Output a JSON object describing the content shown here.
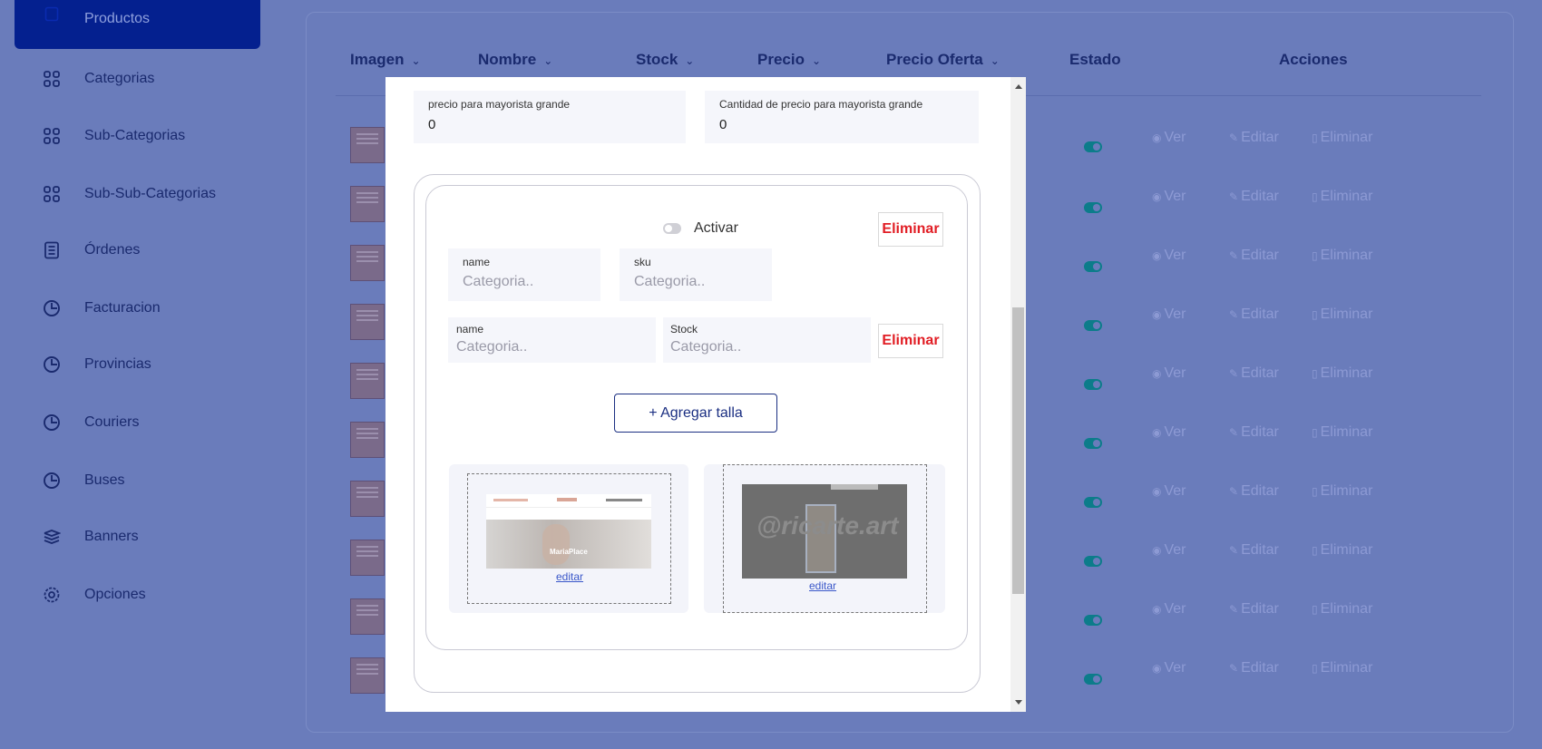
{
  "sidebar": {
    "items": [
      {
        "label": "Productos",
        "icon": "clipboard-icon",
        "active": true
      },
      {
        "label": "Categorias",
        "icon": "grid-icon"
      },
      {
        "label": "Sub-Categorias",
        "icon": "grid-icon"
      },
      {
        "label": "Sub-Sub-Categorias",
        "icon": "grid-icon"
      },
      {
        "label": "Órdenes",
        "icon": "document-icon"
      },
      {
        "label": "Facturacion",
        "icon": "clock-icon"
      },
      {
        "label": "Provincias",
        "icon": "clock-icon"
      },
      {
        "label": "Couriers",
        "icon": "clock-icon"
      },
      {
        "label": "Buses",
        "icon": "clock-icon"
      },
      {
        "label": "Banners",
        "icon": "layers-icon"
      },
      {
        "label": "Opciones",
        "icon": "gear-icon"
      }
    ]
  },
  "table": {
    "headers": [
      "Imagen",
      "Nombre",
      "Stock",
      "Precio",
      "Precio Oferta",
      "Estado",
      "Acciones"
    ],
    "actions": {
      "view": "Ver",
      "edit": "Editar",
      "delete": "Eliminar"
    },
    "row_count": 10,
    "toggle_color": "#0c7c8a"
  },
  "modal": {
    "price_big_wholesale": {
      "label": "precio para mayorista grande",
      "value": "0"
    },
    "qty_big_wholesale": {
      "label": "Cantidad de precio para mayorista grande",
      "value": "0"
    },
    "activar_label": "Activar",
    "delete_label": "Eliminar",
    "variant": {
      "name_label": "name",
      "name_placeholder": "Categoria..",
      "sku_label": "sku",
      "sku_placeholder": "Categoria.."
    },
    "size": {
      "name_label": "name",
      "name_placeholder": "Categoria..",
      "stock_label": "Stock",
      "stock_placeholder": "Categoria.."
    },
    "add_size_label": "+ Agregar talla",
    "images": [
      {
        "edit_label": "editar",
        "overlay_text": "MariaPlace"
      },
      {
        "edit_label": "editar",
        "overlay_text": "@ricarte.art"
      }
    ]
  },
  "colors": {
    "overlay_bg": "#6a7cbb",
    "active_nav": "#04208f",
    "danger": "#e11d24",
    "primary": "#1b2f82"
  }
}
